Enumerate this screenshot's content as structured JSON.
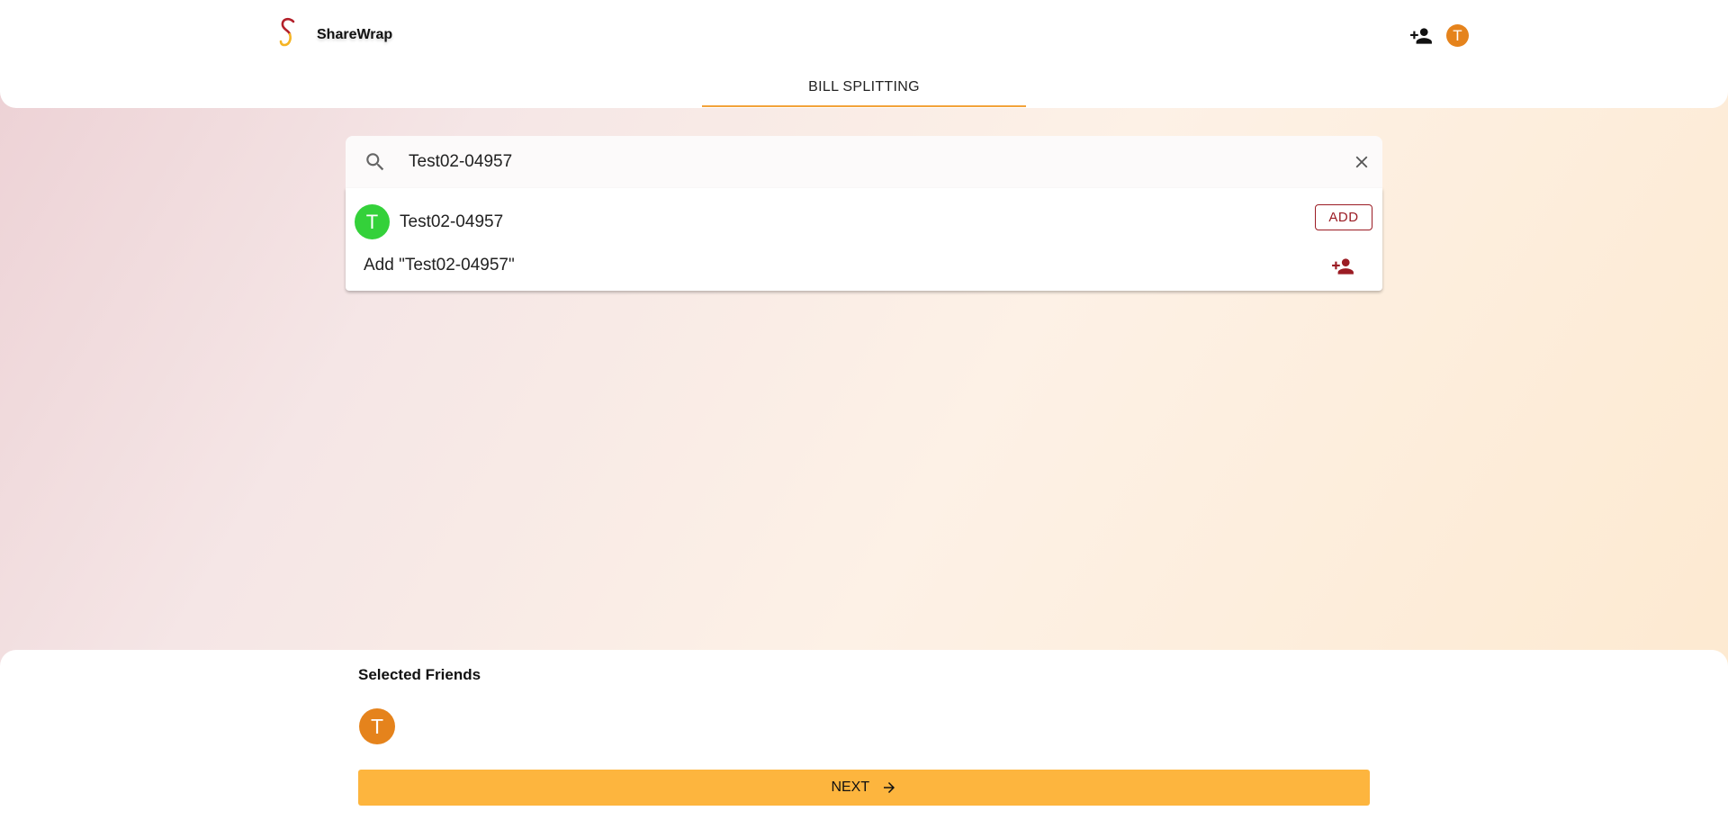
{
  "app": {
    "brand": "ShareWrap",
    "user_initial": "T"
  },
  "nav": {
    "tab_label": "BILL SPLITTING"
  },
  "search": {
    "value": "Test02-04957",
    "placeholder": ""
  },
  "results": [
    {
      "initial": "T",
      "name": "Test02-04957",
      "action_label": "ADD",
      "avatar_color": "#34d13a"
    }
  ],
  "add_new": {
    "label": "Add \"Test02-04957\""
  },
  "selected": {
    "title": "Selected Friends",
    "friends": [
      {
        "initial": "T",
        "avatar_color": "#e5831c"
      }
    ]
  },
  "footer": {
    "next_label": "NEXT"
  },
  "icons": {
    "logo": "sharewrap-logo",
    "add_friend": "person-add-icon",
    "search": "search-icon",
    "clear": "close-icon",
    "next": "arrow-right-icon"
  },
  "colors": {
    "accent": "#fdb53e",
    "tab_indicator": "#f3a33a",
    "brand_red": "#9b1c24",
    "user_avatar": "#e5831c"
  }
}
